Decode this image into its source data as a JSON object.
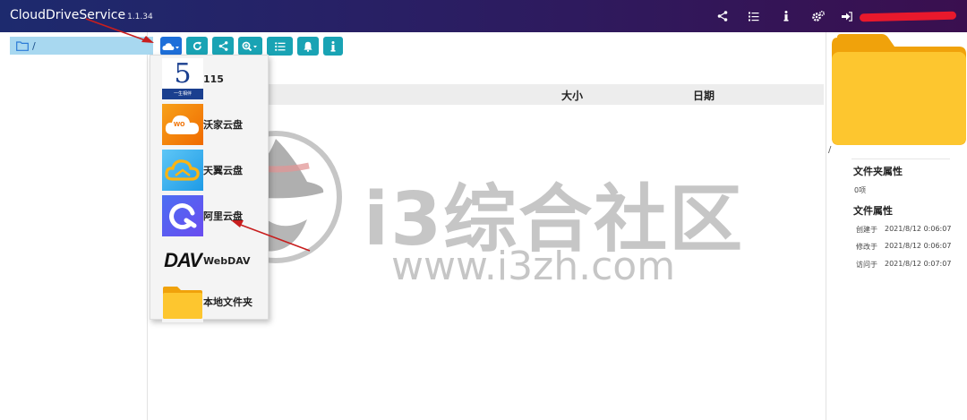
{
  "app": {
    "title": "CloudDriveService",
    "version": "1.1.34"
  },
  "topbar": {
    "icons": [
      "share-icon",
      "list-check-icon",
      "info-icon",
      "gears-icon",
      "logout-icon"
    ]
  },
  "tree": {
    "root_label": "/"
  },
  "toolbar": {
    "buttons": [
      "cloud-add-dropdown",
      "refresh",
      "share",
      "zoom-dropdown",
      "list-view",
      "notifications",
      "info"
    ]
  },
  "dropdown": {
    "items": [
      {
        "label": "115",
        "icon": "115-logo",
        "logo_text": "5",
        "logo_sub": "一生相伴"
      },
      {
        "label": "沃家云盘",
        "icon": "wo-cloud-logo",
        "logo_text": "wo"
      },
      {
        "label": "天翼云盘",
        "icon": "tianyi-cloud-logo"
      },
      {
        "label": "阿里云盘",
        "icon": "aliyun-drive-logo"
      },
      {
        "label": "WebDAV",
        "icon": "webdav-logo",
        "logo_text": "DAV"
      },
      {
        "label": "本地文件夹",
        "icon": "local-folder-icon"
      }
    ]
  },
  "table": {
    "col_size": "大小",
    "col_date": "日期"
  },
  "properties": {
    "path": "/",
    "folder_heading": "文件夹属性",
    "item_count": "0项",
    "file_heading": "文件属性",
    "rows": [
      {
        "label": "创建于",
        "value": "2021/8/12 0:06:07"
      },
      {
        "label": "修改于",
        "value": "2021/8/12 0:06:07"
      },
      {
        "label": "访问于",
        "value": "2021/8/12 0:07:07"
      }
    ]
  },
  "watermark": {
    "title": "i3综合社区",
    "url": "www.i3zh.com"
  },
  "colors": {
    "accent": "#1e6fd9",
    "teal": "#19a3b4",
    "folder": "#fdc62f",
    "annotation": "#c81e1e"
  }
}
